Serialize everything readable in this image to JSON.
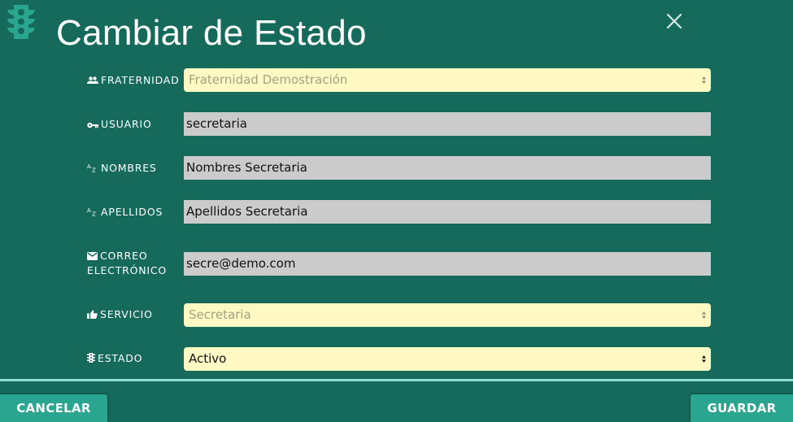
{
  "dialog": {
    "title": "Cambiar de Estado",
    "close_icon": "close-icon",
    "logo_icon": "traffic-light-icon"
  },
  "fields": {
    "fraternidad": {
      "label": "FRATERNIDAD",
      "icon": "people-icon",
      "value": "Fraternidad Demostración",
      "type": "select",
      "disabled": true
    },
    "usuario": {
      "label": "USUARIO",
      "icon": "key-icon",
      "value": "secretaria",
      "type": "input"
    },
    "nombres": {
      "label": "NOMBRES",
      "icon": "sort-az-icon",
      "value": "Nombres Secretaria",
      "type": "input"
    },
    "apellidos": {
      "label": "APELLIDOS",
      "icon": "sort-az-icon",
      "value": "Apellidos Secretaria",
      "type": "input"
    },
    "correo": {
      "label_line1": "CORREO",
      "label_line2": "ELECTRÓNICO",
      "icon": "mail-icon",
      "value": "secre@demo.com",
      "type": "input"
    },
    "servicio": {
      "label": "SERVICIO",
      "icon": "thumb-up-icon",
      "value": "Secretaria",
      "type": "select",
      "disabled": true
    },
    "estado": {
      "label": "ESTADO",
      "icon": "traffic-light-icon",
      "value": "Activo",
      "type": "select",
      "disabled": false
    }
  },
  "footer": {
    "cancel_label": "CANCELAR",
    "save_label": "GUARDAR"
  },
  "colors": {
    "background": "#156a5c",
    "button": "#2aa58f",
    "select_bg": "#fff9c4",
    "input_bg": "#cbcbcb",
    "divider": "#8fe0d4"
  }
}
